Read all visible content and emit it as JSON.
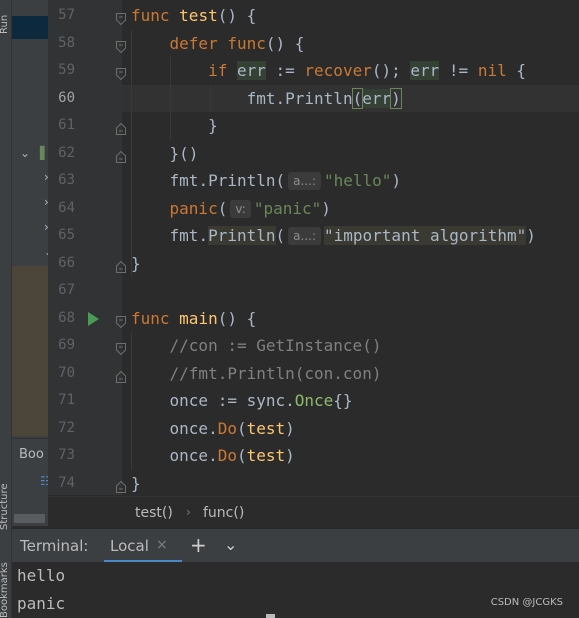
{
  "tool_windows": {
    "run_label": "Run",
    "structure_label": "Structure",
    "bookmarks_label": "Bookmarks",
    "project_tab_label": "Boo"
  },
  "editor": {
    "current_line": 60,
    "lines": [
      {
        "num": "57",
        "tokens": [
          {
            "t": "func",
            "c": "kw"
          },
          {
            "t": " "
          },
          {
            "t": "test",
            "c": "fn"
          },
          {
            "t": "() {"
          }
        ]
      },
      {
        "num": "58",
        "tokens": [
          {
            "t": "    "
          },
          {
            "t": "defer",
            "c": "kw"
          },
          {
            "t": " "
          },
          {
            "t": "func",
            "c": "kw"
          },
          {
            "t": "() {"
          }
        ]
      },
      {
        "num": "59",
        "tokens": [
          {
            "t": "        "
          },
          {
            "t": "if",
            "c": "kw"
          },
          {
            "t": " "
          },
          {
            "t": "err",
            "c": "hl-box"
          },
          {
            "t": " := "
          },
          {
            "t": "recover",
            "c": "kw"
          },
          {
            "t": "(); "
          },
          {
            "t": "err",
            "c": "hl-box"
          },
          {
            "t": " != "
          },
          {
            "t": "nil",
            "c": "kw"
          },
          {
            "t": " {"
          }
        ]
      },
      {
        "num": "60",
        "tokens": [
          {
            "t": "            "
          },
          {
            "t": "fmt",
            "c": "pkg"
          },
          {
            "t": "."
          },
          {
            "t": "Println",
            "c": "mth"
          },
          {
            "t": "(",
            "c": "hl-bracket"
          },
          {
            "t": "err",
            "c": "hl-box"
          },
          {
            "t": ")",
            "c": "hl-bracket"
          }
        ]
      },
      {
        "num": "61",
        "tokens": [
          {
            "t": "        }"
          }
        ]
      },
      {
        "num": "62",
        "tokens": [
          {
            "t": "    }()"
          }
        ]
      },
      {
        "num": "63",
        "tokens": [
          {
            "t": "    "
          },
          {
            "t": "fmt",
            "c": "pkg"
          },
          {
            "t": "."
          },
          {
            "t": "Println",
            "c": "mth"
          },
          {
            "t": "("
          },
          {
            "hint": "a...:"
          },
          {
            "t": "\"hello\"",
            "c": "str"
          },
          {
            "t": ")"
          }
        ]
      },
      {
        "num": "64",
        "tokens": [
          {
            "t": "    "
          },
          {
            "t": "panic",
            "c": "kw"
          },
          {
            "t": "("
          },
          {
            "hint": "v:"
          },
          {
            "t": "\"panic\"",
            "c": "str"
          },
          {
            "t": ")"
          }
        ]
      },
      {
        "num": "65",
        "tokens": [
          {
            "t": "    "
          },
          {
            "t": "fmt",
            "c": "pkg"
          },
          {
            "t": "."
          },
          {
            "t": "Println",
            "c": "hl-method"
          },
          {
            "t": "("
          },
          {
            "hint": "a...:"
          },
          {
            "t": "\"important algorithm\"",
            "c": "hl-str"
          },
          {
            "t": ")"
          }
        ]
      },
      {
        "num": "66",
        "tokens": [
          {
            "t": "}"
          }
        ]
      },
      {
        "num": "67",
        "tokens": []
      },
      {
        "num": "68",
        "tokens": [
          {
            "t": "func",
            "c": "kw"
          },
          {
            "t": " "
          },
          {
            "t": "main",
            "c": "fn"
          },
          {
            "t": "() {"
          }
        ]
      },
      {
        "num": "69",
        "tokens": [
          {
            "t": "    "
          },
          {
            "t": "//con := GetInstance()",
            "c": "cm"
          }
        ]
      },
      {
        "num": "70",
        "tokens": [
          {
            "t": "    "
          },
          {
            "t": "//fmt.Println(con.con)",
            "c": "cm"
          }
        ]
      },
      {
        "num": "71",
        "tokens": [
          {
            "t": "    once := "
          },
          {
            "t": "sync",
            "c": "pkg"
          },
          {
            "t": "."
          },
          {
            "t": "Once",
            "c": "once"
          },
          {
            "t": "{}"
          }
        ]
      },
      {
        "num": "72",
        "tokens": [
          {
            "t": "    once."
          },
          {
            "t": "Do",
            "c": "kw"
          },
          {
            "t": "("
          },
          {
            "t": "test",
            "c": "fn"
          },
          {
            "t": ")"
          }
        ]
      },
      {
        "num": "73",
        "tokens": [
          {
            "t": "    once."
          },
          {
            "t": "Do",
            "c": "kw"
          },
          {
            "t": "("
          },
          {
            "t": "test",
            "c": "fn"
          },
          {
            "t": ")"
          }
        ]
      },
      {
        "num": "74",
        "tokens": [
          {
            "t": "}"
          }
        ]
      }
    ]
  },
  "breadcrumb": {
    "item1": "test()",
    "separator": "›",
    "item2": "func()"
  },
  "terminal": {
    "title": "Terminal:",
    "tab_label": "Local",
    "close_glyph": "×",
    "add_glyph": "+",
    "more_glyph": "⌄",
    "output": [
      "hello",
      "panic"
    ]
  },
  "watermark": "CSDN @JCGKS",
  "colors": {
    "keyword": "#cc7832",
    "function": "#ffc66d",
    "string": "#6a8759",
    "comment": "#808080",
    "run_icon": "#499c54",
    "tab_underline": "#4a88c7"
  }
}
